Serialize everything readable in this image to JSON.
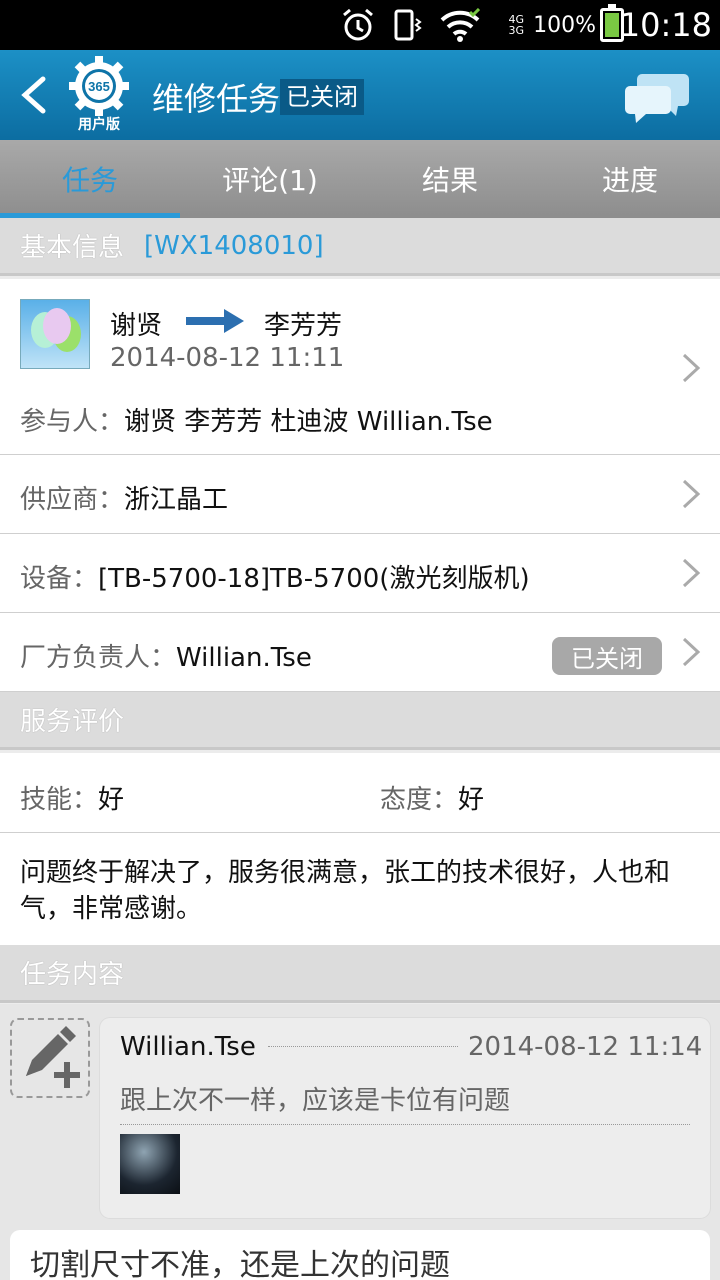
{
  "status_bar": {
    "time": "10:18",
    "battery": "100%",
    "battery_level": 1.0,
    "net_top": "4G",
    "net_bottom": "3G",
    "icons": [
      "alarm-icon",
      "vibrate-icon",
      "wifi-icon",
      "signal-icon",
      "battery-icon"
    ]
  },
  "header": {
    "back_icon": "back-arrow-icon",
    "logo_number": "365",
    "logo_caption": "用户版",
    "title": "维修任务",
    "status": "已关闭",
    "chat_icon": "chat-bubbles-icon",
    "color": "#1581b8"
  },
  "tabs": [
    {
      "label": "任务",
      "active": true
    },
    {
      "label": "评论(1)",
      "active": false
    },
    {
      "label": "结果",
      "active": false
    },
    {
      "label": "进度",
      "active": false
    }
  ],
  "basic": {
    "header": "基本信息",
    "code": "[WX1408010]",
    "from": "谢贤",
    "to": "李芳芳",
    "datetime": "2014-08-12 11:11",
    "participants_label": "参与人：",
    "participants": "谢贤  李芳芳  杜迪波  Willian.Tse",
    "supplier_label": "供应商：",
    "supplier": "浙江晶工",
    "device_label": "设备：",
    "device": "[TB-5700-18]TB-5700(激光刻版机)",
    "owner_label": "厂方负责人：",
    "owner": "Willian.Tse",
    "owner_status": "已关闭"
  },
  "rating": {
    "header": "服务评价",
    "skill_label": "技能：",
    "skill": "好",
    "attitude_label": "态度：",
    "attitude": "好",
    "comment": "问题终于解决了，服务很满意，张工的技术很好，人也和气，非常感谢。"
  },
  "content": {
    "header": "任务内容",
    "entries": [
      {
        "author": "Willian.Tse",
        "time": "2014-08-12 11:14",
        "text": "跟上次不一样，应该是卡位有问题"
      }
    ],
    "next_text": "切割尺寸不准，还是上次的问题"
  },
  "colors": {
    "accent": "#2a9ad8",
    "tab_bg": "#9a9a9a",
    "badge": "#a8a8a8"
  }
}
